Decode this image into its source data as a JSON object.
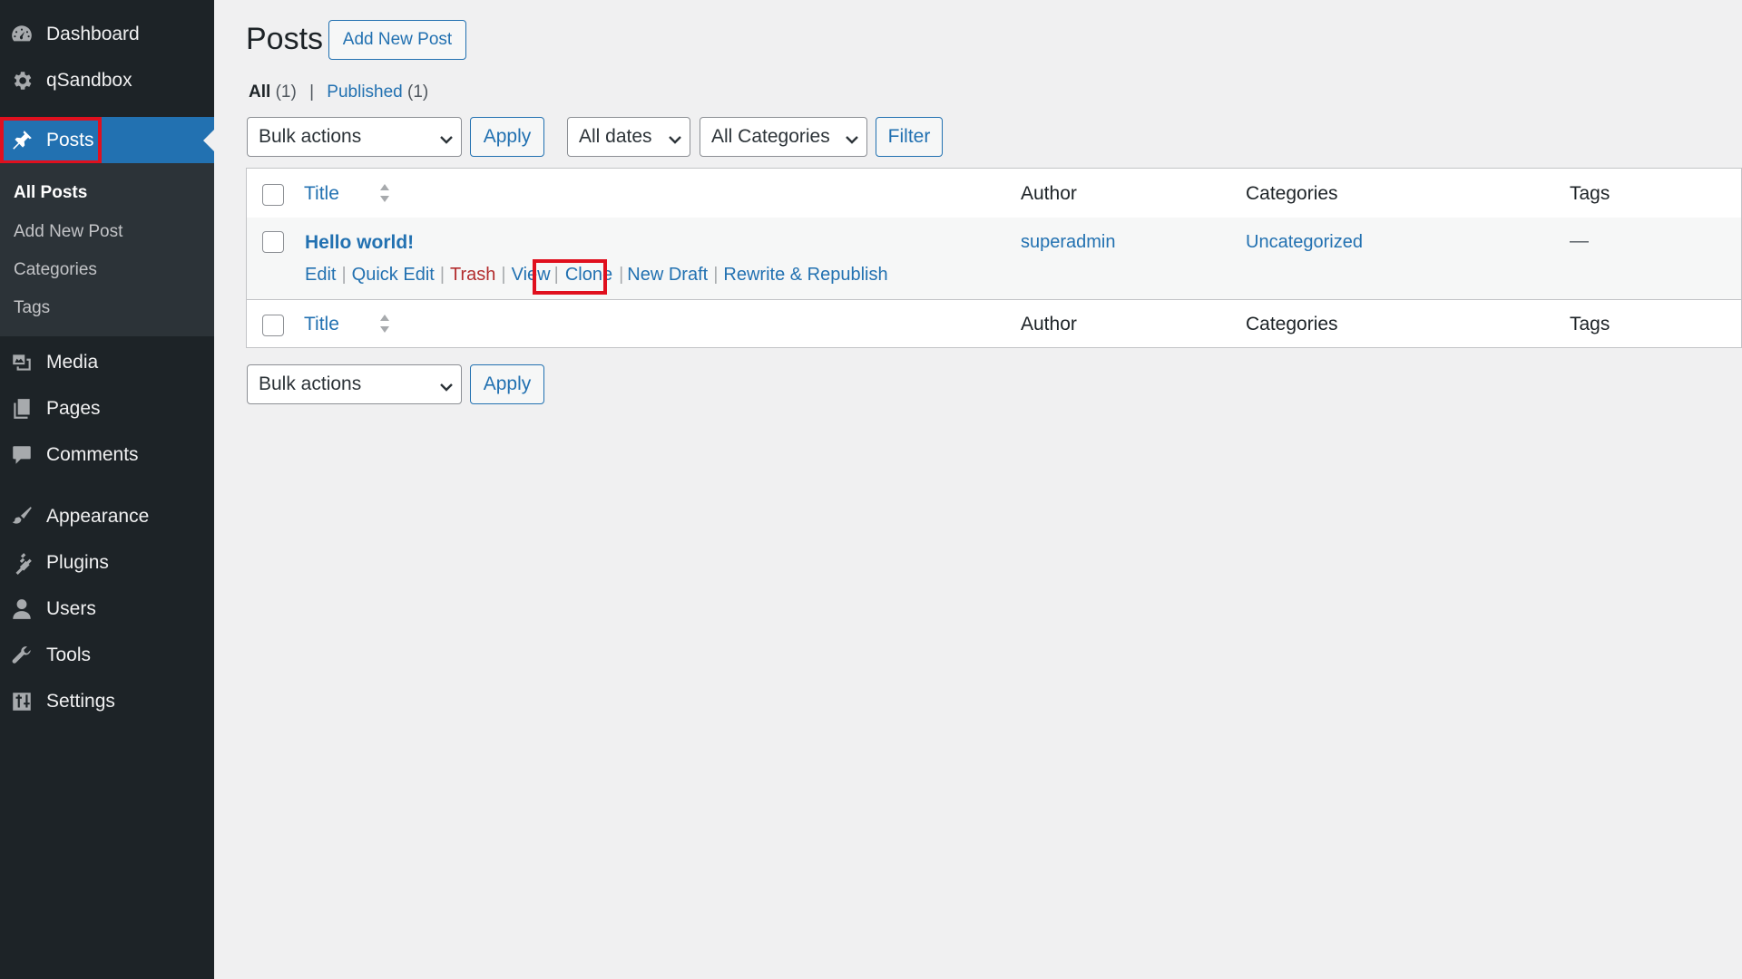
{
  "sidebar": {
    "items": [
      {
        "label": "Dashboard",
        "icon": "dashboard-icon"
      },
      {
        "label": "qSandbox",
        "icon": "gear-icon"
      },
      {
        "label": "Posts",
        "icon": "pushpin-icon",
        "active": true
      },
      {
        "label": "Media",
        "icon": "media-icon"
      },
      {
        "label": "Pages",
        "icon": "pages-icon"
      },
      {
        "label": "Comments",
        "icon": "comments-icon"
      },
      {
        "label": "Appearance",
        "icon": "paintbrush-icon"
      },
      {
        "label": "Plugins",
        "icon": "plugin-icon"
      },
      {
        "label": "Users",
        "icon": "users-icon"
      },
      {
        "label": "Tools",
        "icon": "wrench-icon"
      },
      {
        "label": "Settings",
        "icon": "settings-icon"
      }
    ],
    "submenu": [
      "All Posts",
      "Add New Post",
      "Categories",
      "Tags"
    ]
  },
  "header": {
    "title": "Posts",
    "add_new_label": "Add New Post"
  },
  "views": {
    "all_label": "All",
    "all_count": "(1)",
    "separator": "|",
    "published_label": "Published",
    "published_count": "(1)"
  },
  "filters": {
    "bulk_actions": "Bulk actions",
    "apply_label": "Apply",
    "dates": "All dates",
    "categories": "All Categories",
    "filter_label": "Filter"
  },
  "table": {
    "columns": {
      "title": "Title",
      "author": "Author",
      "categories": "Categories",
      "tags": "Tags"
    },
    "rows": [
      {
        "title": "Hello world!",
        "author": "superadmin",
        "categories": "Uncategorized",
        "tags": "—",
        "actions": [
          "Edit",
          "Quick Edit",
          "Trash",
          "View",
          "Clone",
          "New Draft",
          "Rewrite & Republish"
        ]
      }
    ]
  },
  "bottom": {
    "bulk_actions": "Bulk actions",
    "apply_label": "Apply"
  },
  "colors": {
    "sidebar_bg": "#1d2327",
    "active_bg": "#2271b1",
    "link": "#2271b1",
    "trash": "#b32d2e",
    "highlight": "#e0101e"
  }
}
